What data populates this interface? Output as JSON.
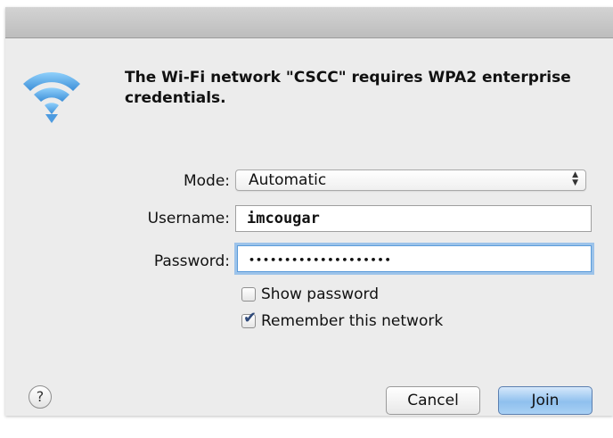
{
  "dialog": {
    "message": "The Wi-Fi network \"CSCC\" requires WPA2 enterprise credentials.",
    "icon": "wifi-icon"
  },
  "form": {
    "mode_label": "Mode:",
    "mode_value": "Automatic",
    "username_label": "Username:",
    "username_value": "imcougar",
    "password_label": "Password:",
    "password_value": "••••••••••••••••••••"
  },
  "options": {
    "show_password_label": "Show password",
    "show_password_checked": false,
    "remember_label": "Remember this network",
    "remember_checked": true
  },
  "buttons": {
    "help": "?",
    "cancel": "Cancel",
    "join": "Join"
  },
  "colors": {
    "wifi": "#5aa7e8",
    "join_button": "#8fc0ee",
    "focus_ring": "#9cc3ea"
  }
}
